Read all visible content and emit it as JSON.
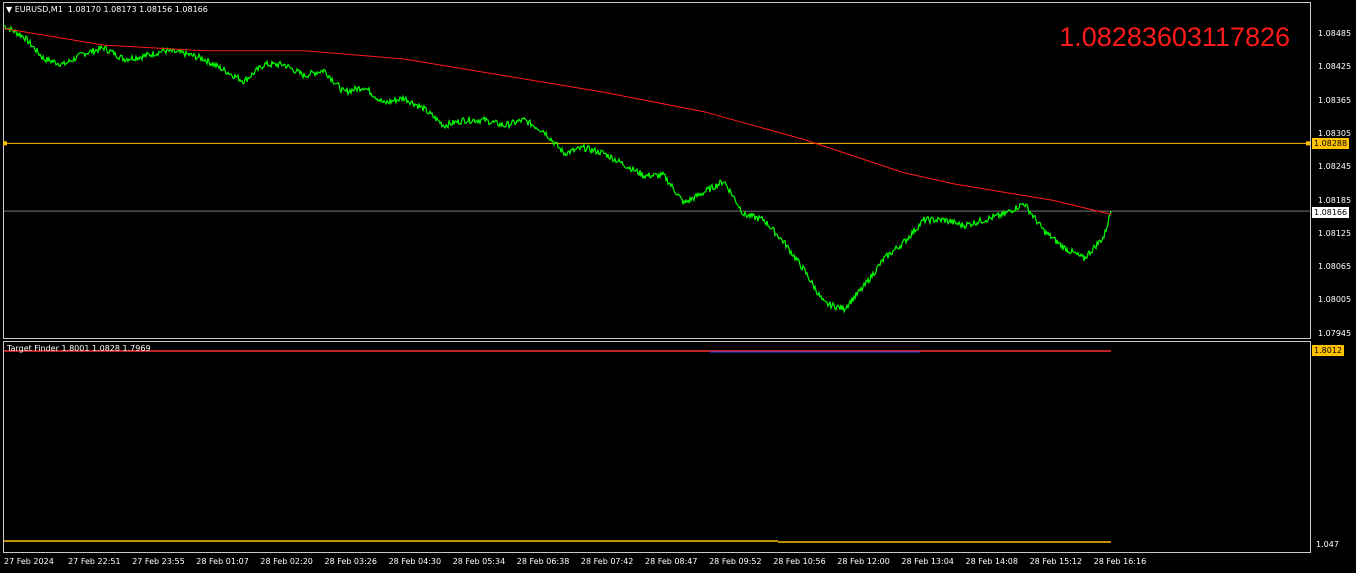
{
  "main": {
    "symbol_label": "EURUSD,M1",
    "ohlc": "1.08170 1.08173 1.08156 1.08166",
    "big_value": "1.08283603117826",
    "price_ticks": [
      "1.08485",
      "1.08425",
      "1.08365",
      "1.08305",
      "1.08245",
      "1.08185",
      "1.08125",
      "1.08065",
      "1.08005",
      "1.07945"
    ],
    "hline_price_tag": "1.08288",
    "current_price_tag": "1.08166",
    "colors": {
      "price": "#00ff00",
      "ma": "#ff1a1a",
      "hline": "#ffc000",
      "current": "#c0c0c0"
    }
  },
  "sub": {
    "title": "Target Finder 1.8001 1.0828 1.7969",
    "top_tag": "1.8012",
    "bottom_tick": "1.047",
    "colors": {
      "top_line": "#ff3030",
      "bottom_line": "#ffc000"
    }
  },
  "time_axis": [
    "27 Feb 2024",
    "27 Feb 22:51",
    "27 Feb 23:55",
    "28 Feb 01:07",
    "28 Feb 02:20",
    "28 Feb 03:26",
    "28 Feb 04:30",
    "28 Feb 05:34",
    "28 Feb 06:38",
    "28 Feb 07:42",
    "28 Feb 08:47",
    "28 Feb 09:52",
    "28 Feb 10:56",
    "28 Feb 12:00",
    "28 Feb 13:04",
    "28 Feb 14:08",
    "28 Feb 15:12",
    "28 Feb 16:16"
  ],
  "chart_data": {
    "type": "line",
    "series": [
      {
        "name": "",
        "x_index": [
          0,
          20,
          40,
          60,
          80,
          100,
          120,
          140,
          160,
          180,
          200,
          220,
          240,
          260,
          280,
          300,
          320,
          340,
          360,
          380,
          400,
          420,
          440,
          460,
          480,
          500,
          520,
          540,
          560,
          580,
          600,
          620,
          640,
          660,
          680,
          700,
          720,
          740,
          760,
          780,
          800,
          820,
          840,
          860,
          880,
          900,
          920,
          940,
          960,
          980,
          1000,
          1020,
          1040,
          1060,
          1080,
          1100,
          1107
        ],
        "values": [
          1.085,
          1.0848,
          1.0844,
          1.0843,
          1.0845,
          1.0846,
          1.0844,
          1.08445,
          1.08455,
          1.0845,
          1.0844,
          1.0842,
          1.084,
          1.0843,
          1.0843,
          1.0841,
          1.0842,
          1.0838,
          1.0839,
          1.0836,
          1.0837,
          1.0835,
          1.0832,
          1.0833,
          1.0833,
          1.0832,
          1.0833,
          1.0831,
          1.0827,
          1.0828,
          1.0827,
          1.0825,
          1.0823,
          1.0823,
          1.0818,
          1.082,
          1.0822,
          1.0816,
          1.0815,
          1.0811,
          1.0806,
          1.08,
          1.0799,
          1.0803,
          1.0808,
          1.0811,
          1.0815,
          1.0815,
          1.0814,
          1.0815,
          1.0816,
          1.0818,
          1.0813,
          1.081,
          1.0808,
          1.0812,
          1.08166
        ]
      },
      {
        "name": "",
        "x_index": [
          0,
          100,
          200,
          300,
          400,
          500,
          600,
          700,
          800,
          850,
          900,
          950,
          1000,
          1050,
          1107
        ],
        "values": [
          1.08495,
          1.08465,
          1.08455,
          1.08455,
          1.0844,
          1.0841,
          1.0838,
          1.08345,
          1.08295,
          1.08265,
          1.08235,
          1.08215,
          1.082,
          1.08185,
          1.0816
        ]
      }
    ],
    "ylim": [
      1.0793,
      1.0852
    ],
    "grid": false
  }
}
